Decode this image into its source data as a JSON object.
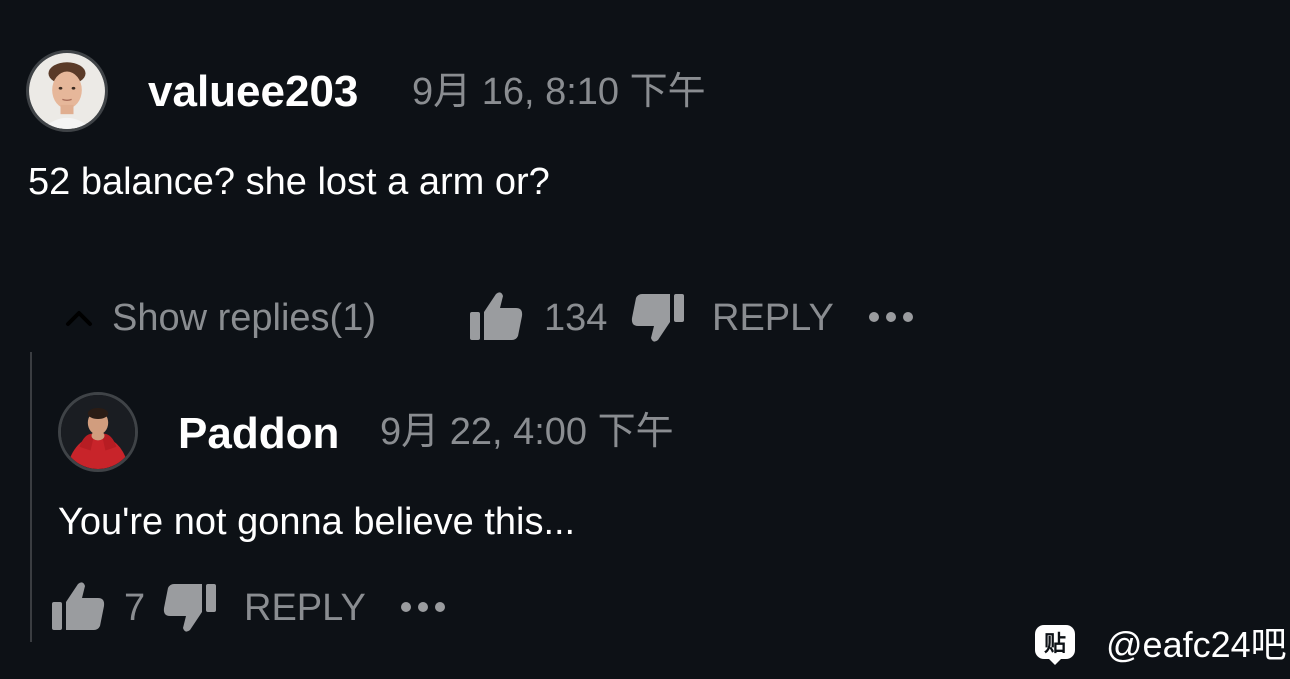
{
  "comment": {
    "username": "valuee203",
    "timestamp": "9月 16, 8:10 下午",
    "text": "52 balance? she lost a arm or?",
    "show_replies_label": "Show replies(1)",
    "like_count": "134",
    "reply_label": "REPLY",
    "more_icon": "more-dots-icon"
  },
  "reply": {
    "username": "Paddon",
    "timestamp": "9月 22, 4:00 下午",
    "text": "You're not gonna believe this...",
    "like_count": "7",
    "reply_label": "REPLY",
    "more_icon": "more-dots-icon"
  },
  "watermark": {
    "logo_glyph": "贴",
    "text": "@eafc24吧"
  },
  "colors": {
    "background": "#0d1116",
    "text_primary": "#ffffff",
    "text_secondary": "#8a8d91",
    "icon_gray": "#9a9c9f",
    "avatar_border": "#3f4347"
  }
}
